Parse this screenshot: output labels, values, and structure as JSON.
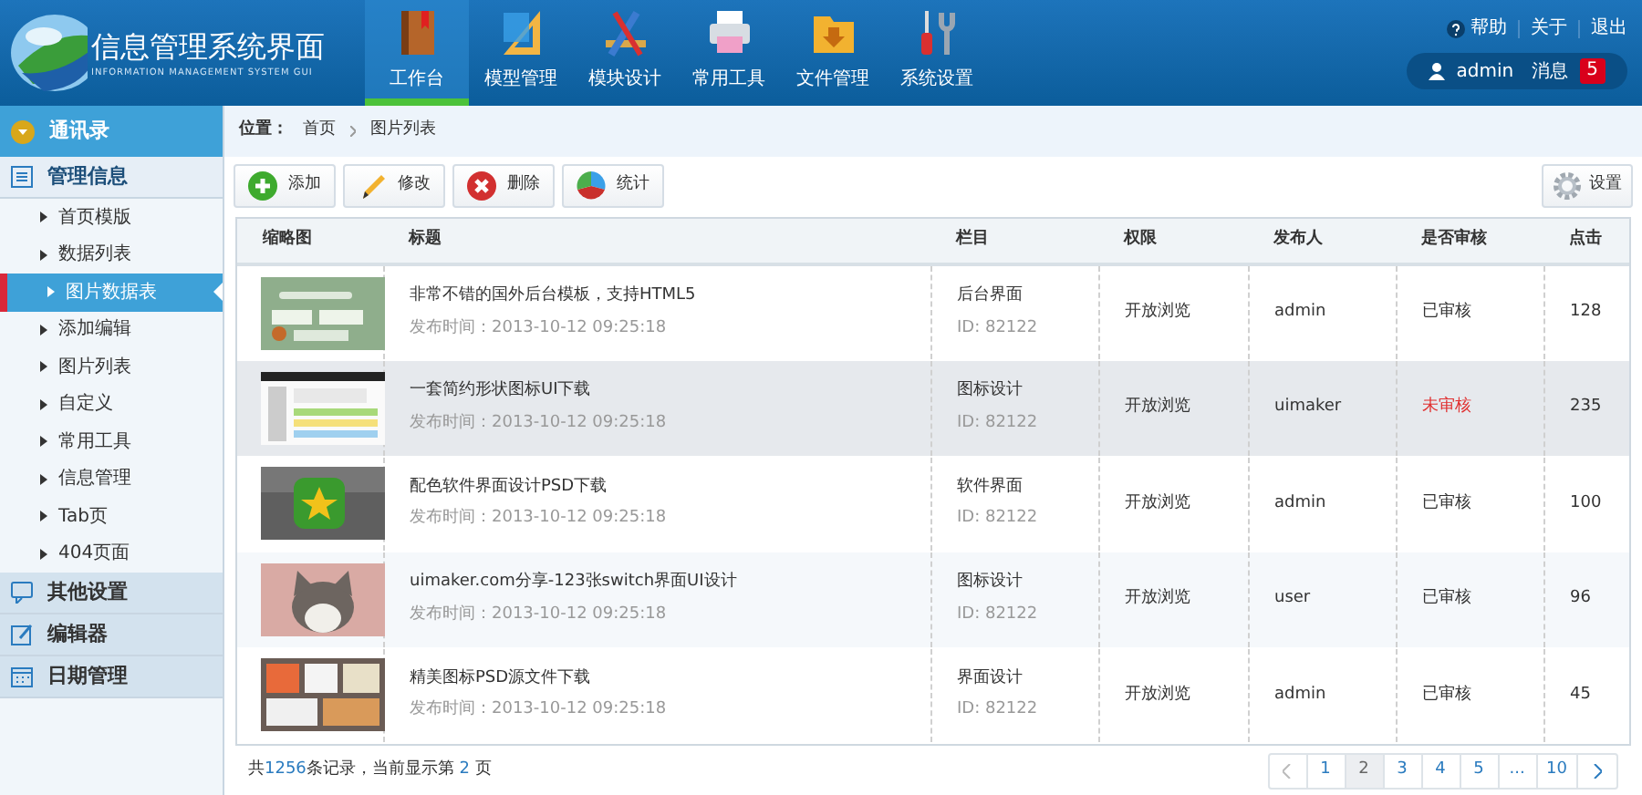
{
  "header": {
    "title": "信息管理系统界面",
    "subtitle": "INFORMATION MANAGEMENT SYSTEM GUI",
    "nav": [
      {
        "label": "工作台",
        "selected": true
      },
      {
        "label": "模型管理",
        "selected": false
      },
      {
        "label": "模块设计",
        "selected": false
      },
      {
        "label": "常用工具",
        "selected": false
      },
      {
        "label": "文件管理",
        "selected": false
      },
      {
        "label": "系统设置",
        "selected": false
      }
    ],
    "links": [
      "帮助",
      "关于",
      "退出"
    ],
    "user": "admin",
    "messages_label": "消息",
    "messages_count": "5"
  },
  "sidebar": [
    {
      "label": "通讯录",
      "kind": "top",
      "expanded": false
    },
    {
      "label": "管理信息",
      "kind": "group",
      "expanded": true,
      "children": [
        {
          "label": "首页模版",
          "selected": false
        },
        {
          "label": "数据列表",
          "selected": false
        },
        {
          "label": "图片数据表",
          "selected": true
        },
        {
          "label": "添加编辑",
          "selected": false
        },
        {
          "label": "图片列表",
          "selected": false
        },
        {
          "label": "自定义",
          "selected": false
        },
        {
          "label": "常用工具",
          "selected": false
        },
        {
          "label": "信息管理",
          "selected": false
        },
        {
          "label": "Tab页",
          "selected": false
        },
        {
          "label": "404页面",
          "selected": false
        }
      ]
    },
    {
      "label": "其他设置",
      "kind": "group",
      "expanded": false
    },
    {
      "label": "编辑器",
      "kind": "group",
      "expanded": false
    },
    {
      "label": "日期管理",
      "kind": "group",
      "expanded": false
    }
  ],
  "breadcrumb": {
    "label": "位置：",
    "items": [
      "首页",
      "图片列表"
    ]
  },
  "toolbar": [
    "添加",
    "修改",
    "删除",
    "统计"
  ],
  "settings_button": "设置",
  "table": {
    "columns": [
      "缩略图",
      "标题",
      "栏目",
      "权限",
      "发布人",
      "是否审核",
      "点击"
    ],
    "rows": [
      {
        "selected": false,
        "title": "非常不错的国外后台模板，支持HTML5",
        "date": "发布时间：2013-10-12 09:25:18",
        "category": "后台界面",
        "id": "ID: 82122",
        "permission": "开放浏览",
        "author": "admin",
        "review": "已审核",
        "approved": true,
        "clicks": "128"
      },
      {
        "selected": true,
        "title": "一套简约形状图标UI下载",
        "date": "发布时间：2013-10-12 09:25:18",
        "category": "图标设计",
        "id": "ID: 82122",
        "permission": "开放浏览",
        "author": "uimaker",
        "review": "未审核",
        "approved": false,
        "clicks": "235"
      },
      {
        "selected": false,
        "title": "配色软件界面设计PSD下载",
        "date": "发布时间：2013-10-12 09:25:18",
        "category": "软件界面",
        "id": "ID: 82122",
        "permission": "开放浏览",
        "author": "admin",
        "review": "已审核",
        "approved": true,
        "clicks": "100"
      },
      {
        "selected": false,
        "title": "uimaker.com分享-123张switch界面UI设计",
        "date": "发布时间：2013-10-12 09:25:18",
        "category": "图标设计",
        "id": "ID: 82122",
        "permission": "开放浏览",
        "author": "user",
        "review": "已审核",
        "approved": true,
        "clicks": "96"
      },
      {
        "selected": false,
        "title": "精美图标PSD源文件下载",
        "date": "发布时间：2013-10-12 09:25:18",
        "category": "界面设计",
        "id": "ID: 82122",
        "permission": "开放浏览",
        "author": "admin",
        "review": "已审核",
        "approved": true,
        "clicks": "45"
      }
    ]
  },
  "footer": {
    "summary": "共**1256**条记录，当前显示第 **2** 页",
    "pages": [
      {
        "label": "1",
        "selected": false
      },
      {
        "label": "2",
        "selected": true
      },
      {
        "label": "3",
        "selected": false
      },
      {
        "label": "4",
        "selected": false
      },
      {
        "label": "5",
        "selected": false
      },
      {
        "label": "...",
        "selected": false
      },
      {
        "label": "10",
        "selected": false
      }
    ]
  }
}
